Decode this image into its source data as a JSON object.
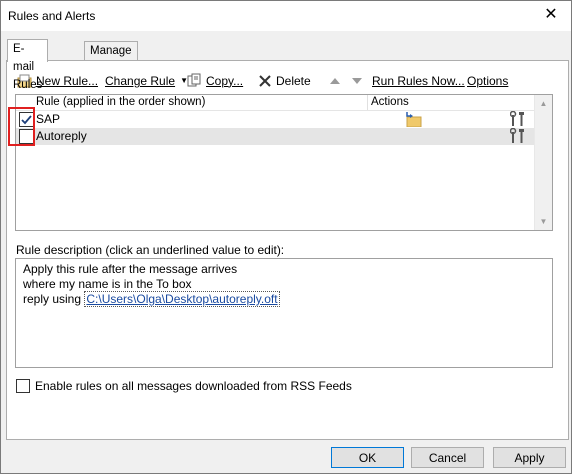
{
  "window": {
    "title": "Rules and Alerts",
    "close_glyph": "✕"
  },
  "tabs": [
    {
      "label": "E-mail Rules",
      "active": true
    },
    {
      "label": "Manage Alerts",
      "active": false
    }
  ],
  "toolbar": {
    "new_rule": "New Rule...",
    "change_rule": "Change Rule",
    "copy": "Copy...",
    "delete": "Delete",
    "run_rules_now": "Run Rules Now...",
    "options": "Options"
  },
  "rules_list": {
    "columns": [
      "Rule (applied in the order shown)",
      "Actions"
    ],
    "rows": [
      {
        "name": "SAP",
        "checked": true,
        "selected": false
      },
      {
        "name": "Autoreply",
        "checked": false,
        "selected": true
      }
    ]
  },
  "description": {
    "label": "Rule description (click an underlined value to edit):",
    "line1": "Apply this rule after the message arrives",
    "line2": "where my name is in the To box",
    "line3_prefix": "reply using",
    "line3_link": "C:\\Users\\Olga\\Desktop\\autoreply.oft"
  },
  "rss": {
    "label": "Enable rules on all messages downloaded from RSS Feeds",
    "checked": false
  },
  "buttons": {
    "ok": "OK",
    "cancel": "Cancel",
    "apply": "Apply"
  },
  "colors": {
    "highlight": "#e02020",
    "link": "#1a4aa0",
    "checkmark": "#1f3f7a"
  }
}
